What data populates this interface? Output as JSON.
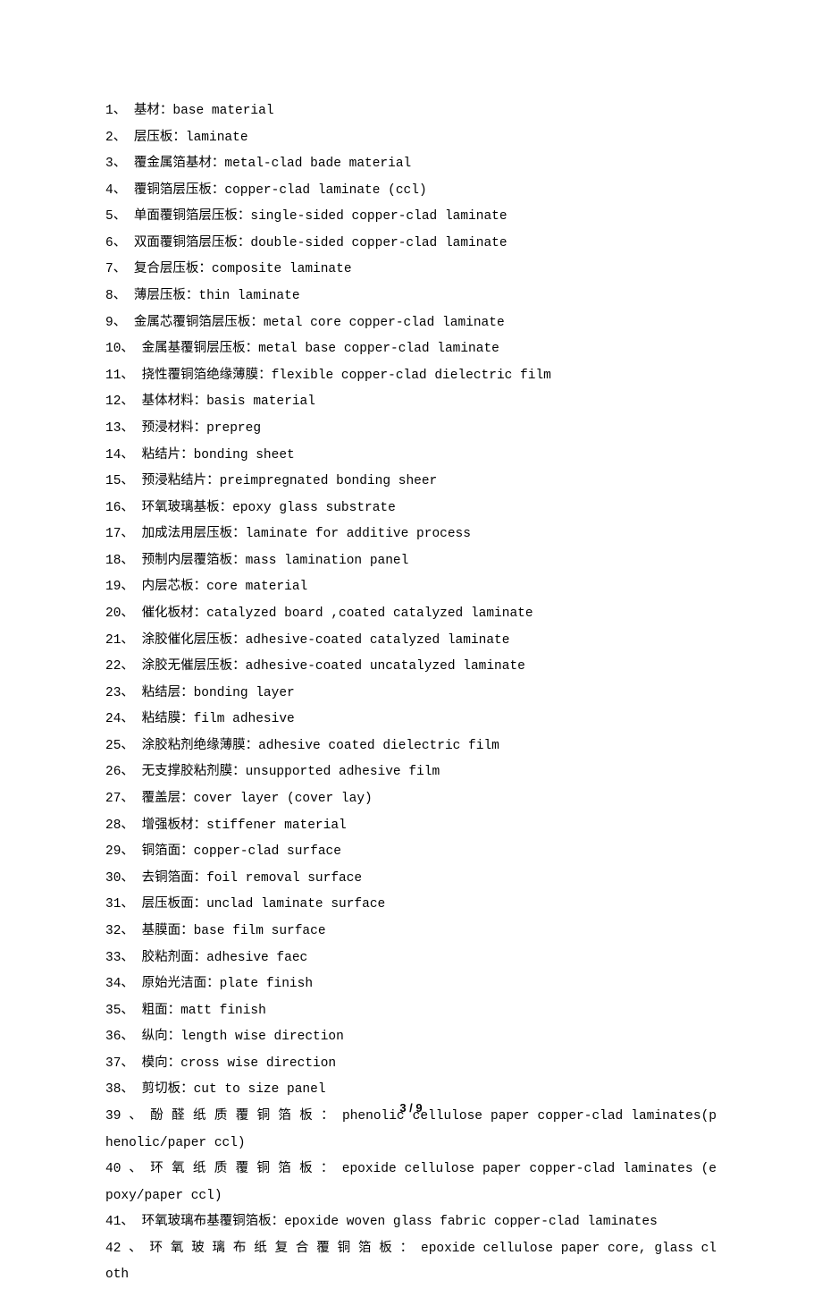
{
  "page_number": "3 / 9",
  "entries": [
    {
      "n": "1、",
      "zh": "基材：",
      "en": "base material"
    },
    {
      "n": "2、",
      "zh": "层压板：",
      "en": "laminate"
    },
    {
      "n": "3、",
      "zh": "覆金属箔基材：",
      "en": "metal-clad bade material"
    },
    {
      "n": "4、",
      "zh": "覆铜箔层压板：",
      "en": "copper-clad laminate (ccl)"
    },
    {
      "n": "5、",
      "zh": "单面覆铜箔层压板：",
      "en": "single-sided copper-clad laminate"
    },
    {
      "n": "6、",
      "zh": "双面覆铜箔层压板：",
      "en": "double-sided copper-clad laminate"
    },
    {
      "n": "7、",
      "zh": "复合层压板：",
      "en": "composite laminate"
    },
    {
      "n": "8、",
      "zh": "薄层压板：",
      "en": "thin laminate"
    },
    {
      "n": "9、",
      "zh": "金属芯覆铜箔层压板：",
      "en": "metal core copper-clad laminate"
    },
    {
      "n": "10、",
      "zh": "金属基覆铜层压板：",
      "en": "metal base copper-clad laminate"
    },
    {
      "n": "11、",
      "zh": "挠性覆铜箔绝缘薄膜：",
      "en": "flexible copper-clad dielectric film"
    },
    {
      "n": "12、",
      "zh": "基体材料：",
      "en": "basis material"
    },
    {
      "n": "13、",
      "zh": "预浸材料：",
      "en": "prepreg"
    },
    {
      "n": "14、",
      "zh": "粘结片：",
      "en": "bonding sheet"
    },
    {
      "n": "15、",
      "zh": "预浸粘结片：",
      "en": "preimpregnated bonding sheer"
    },
    {
      "n": "16、",
      "zh": "环氧玻璃基板：",
      "en": "epoxy glass substrate"
    },
    {
      "n": "17、",
      "zh": "加成法用层压板：",
      "en": "laminate for additive process"
    },
    {
      "n": "18、",
      "zh": "预制内层覆箔板：",
      "en": "mass lamination panel"
    },
    {
      "n": "19、",
      "zh": "内层芯板：",
      "en": "core material"
    },
    {
      "n": "20、",
      "zh": "催化板材：",
      "en": "catalyzed board ,coated catalyzed laminate"
    },
    {
      "n": "21、",
      "zh": "涂胶催化层压板：",
      "en": "adhesive-coated catalyzed laminate"
    },
    {
      "n": "22、",
      "zh": "涂胶无催层压板：",
      "en": "adhesive-coated uncatalyzed laminate"
    },
    {
      "n": "23、",
      "zh": "粘结层：",
      "en": "bonding layer"
    },
    {
      "n": "24、",
      "zh": "粘结膜：",
      "en": "film adhesive"
    },
    {
      "n": "25、",
      "zh": "涂胶粘剂绝缘薄膜：",
      "en": "adhesive coated dielectric film"
    },
    {
      "n": "26、",
      "zh": "无支撑胶粘剂膜：",
      "en": "unsupported adhesive film"
    },
    {
      "n": "27、",
      "zh": "覆盖层：",
      "en": "cover layer (cover lay)"
    },
    {
      "n": "28、",
      "zh": "增强板材：",
      "en": "stiffener material"
    },
    {
      "n": "29、",
      "zh": "铜箔面：",
      "en": "copper-clad surface"
    },
    {
      "n": "30、",
      "zh": "去铜箔面：",
      "en": "foil removal surface"
    },
    {
      "n": "31、",
      "zh": "层压板面：",
      "en": "unclad laminate surface"
    },
    {
      "n": "32、",
      "zh": "基膜面：",
      "en": "base film surface"
    },
    {
      "n": "33、",
      "zh": "胶粘剂面：",
      "en": "adhesive faec"
    },
    {
      "n": "34、",
      "zh": "原始光洁面：",
      "en": "plate finish"
    },
    {
      "n": "35、",
      "zh": "粗面：",
      "en": "matt finish"
    },
    {
      "n": "36、",
      "zh": "纵向：",
      "en": "length wise direction"
    },
    {
      "n": "37、",
      "zh": "模向：",
      "en": "cross wise direction"
    },
    {
      "n": "38、",
      "zh": "剪切板：",
      "en": "cut to size panel"
    },
    {
      "n": "39 、",
      "zh": "  酚 醛 纸 质 覆 铜 箔 板 ：",
      "en": " phenolic  cellulose  paper  copper-clad laminates(phenolic/paper ccl)",
      "spread": true
    },
    {
      "n": "40 、",
      "zh": "  环 氧 纸 质 覆 铜 箔 板 ：",
      "en": " epoxide cellulose paper copper-clad laminates (epoxy/paper ccl)",
      "spread": true
    },
    {
      "n": "41、",
      "zh": "环氧玻璃布基覆铜箔板：",
      "en": "epoxide woven glass fabric copper-clad laminates"
    },
    {
      "n": "42 、",
      "zh": " 环 氧 玻 璃 布 纸 复 合 覆 铜 箔 板 ：",
      "en": " epoxide cellulose paper core, glass cloth",
      "spread": true
    }
  ]
}
